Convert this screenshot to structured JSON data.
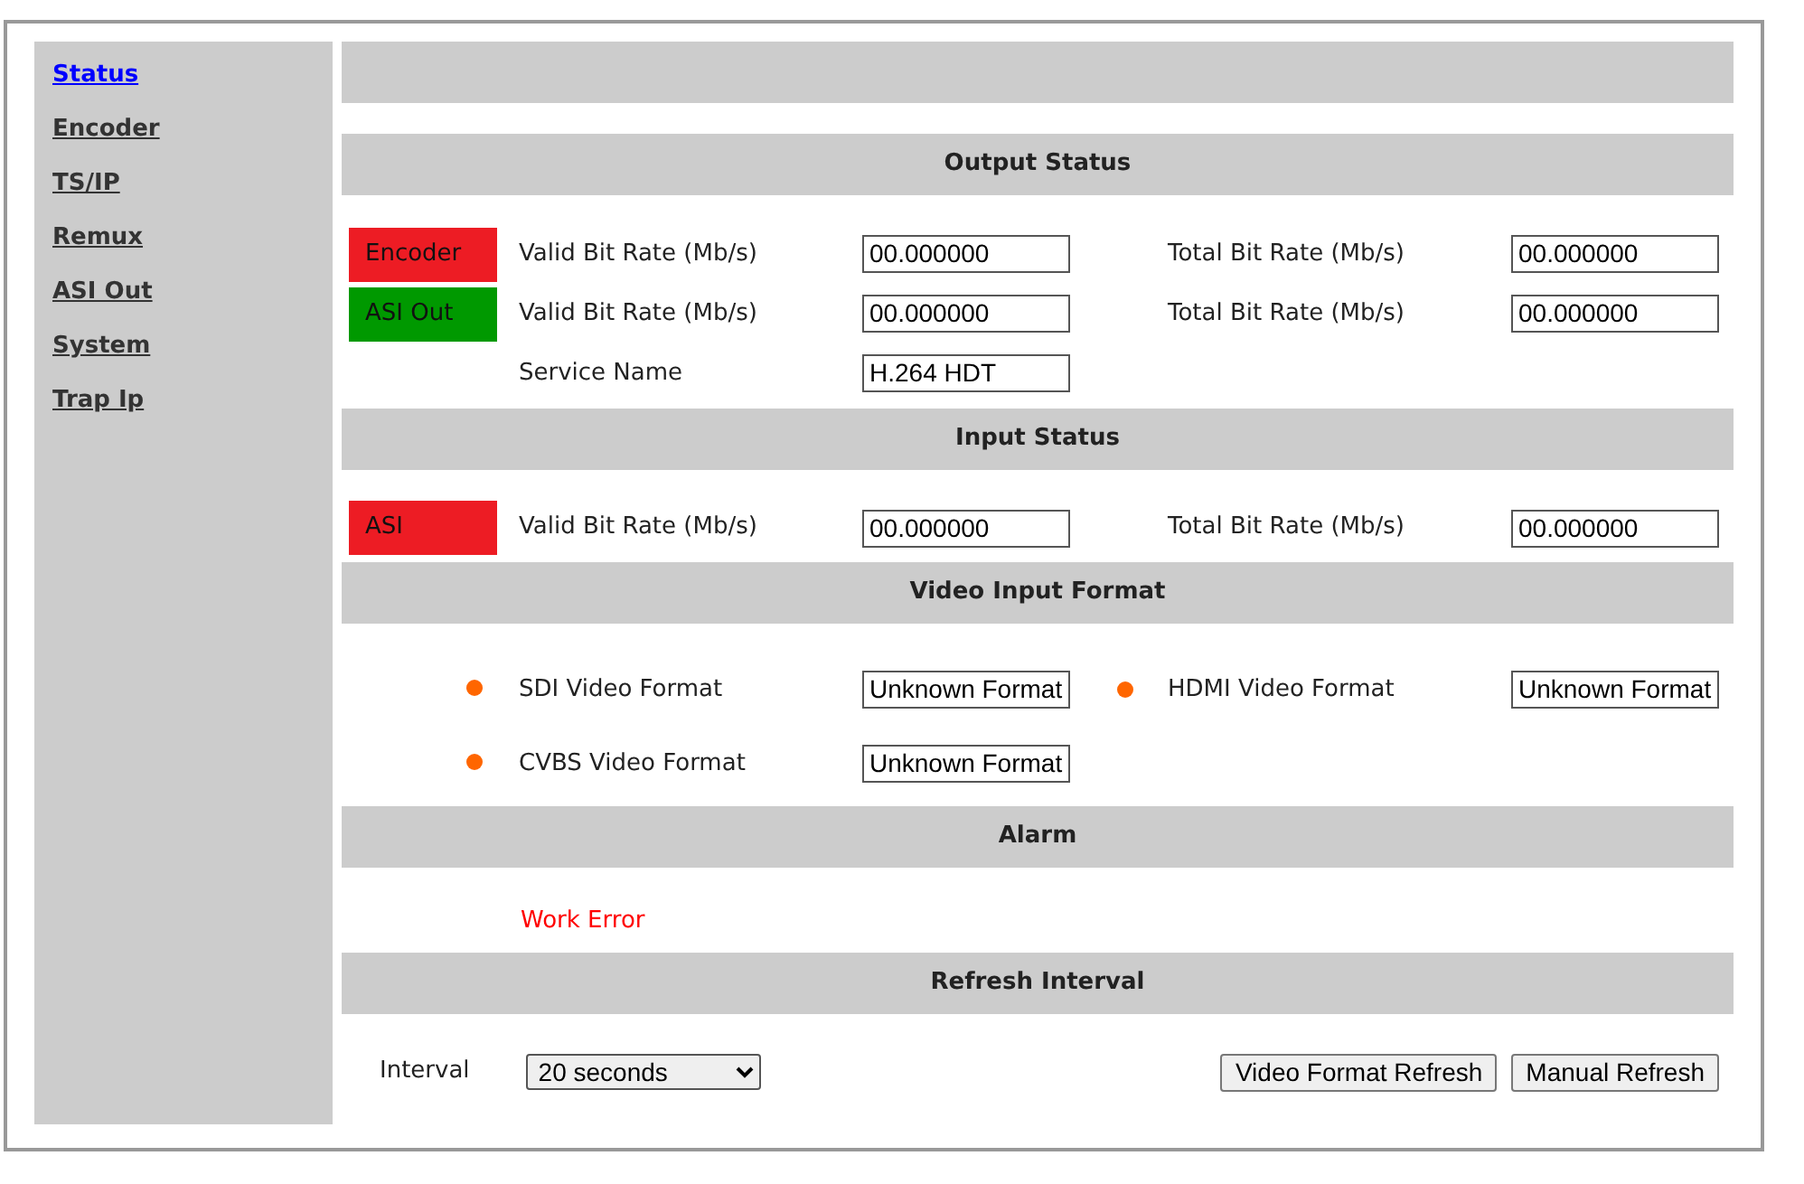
{
  "sidebar": {
    "items": [
      {
        "label": "Status",
        "selected": true
      },
      {
        "label": "Encoder",
        "selected": false
      },
      {
        "label": "TS/IP",
        "selected": false
      },
      {
        "label": "Remux",
        "selected": false
      },
      {
        "label": "ASI Out",
        "selected": false
      },
      {
        "label": "System",
        "selected": false
      },
      {
        "label": "Trap Ip",
        "selected": false
      }
    ]
  },
  "sections": [
    {
      "kind": "fields",
      "title": "Output Status",
      "rows": [
        {
          "indicator": {
            "label": "Encoder",
            "color": "#ed1c24"
          },
          "fields": [
            {
              "label": "Valid Bit Rate (Mb/s)",
              "value": "00.000000"
            },
            {
              "label": "Total Bit Rate (Mb/s)",
              "value": "00.000000"
            }
          ]
        },
        {
          "indicator": {
            "label": "ASI Out",
            "color": "#009900"
          },
          "fields": [
            {
              "label": "Valid Bit Rate (Mb/s)",
              "value": "00.000000"
            },
            {
              "label": "Total Bit Rate (Mb/s)",
              "value": "00.000000"
            }
          ]
        },
        {
          "fields": [
            {
              "label": "Service Name",
              "value": "H.264 HDT"
            }
          ]
        }
      ]
    },
    {
      "kind": "fields",
      "title": "Input Status",
      "rows": [
        {
          "indicator": {
            "label": "ASI",
            "color": "#ed1c24"
          },
          "fields": [
            {
              "label": "Valid Bit Rate (Mb/s)",
              "value": "00.000000"
            },
            {
              "label": "Total Bit Rate (Mb/s)",
              "value": "00.000000"
            }
          ]
        }
      ]
    },
    {
      "kind": "formats",
      "title": "Video Input Format",
      "rows": [
        {
          "fields": [
            {
              "label": "SDI Video Format",
              "value": "Unknown Format"
            },
            {
              "label": "HDMI Video Format",
              "value": "Unknown Format"
            }
          ]
        },
        {
          "fields": [
            {
              "label": "CVBS Video Format",
              "value": "Unknown Format"
            }
          ]
        }
      ]
    },
    {
      "kind": "alarm",
      "title": "Alarm",
      "message": "Work Error"
    },
    {
      "kind": "refresh",
      "title": "Refresh Interval",
      "interval_label": "Interval",
      "interval_value": "20 seconds",
      "buttons": [
        "Video Format Refresh",
        "Manual Refresh"
      ]
    }
  ]
}
